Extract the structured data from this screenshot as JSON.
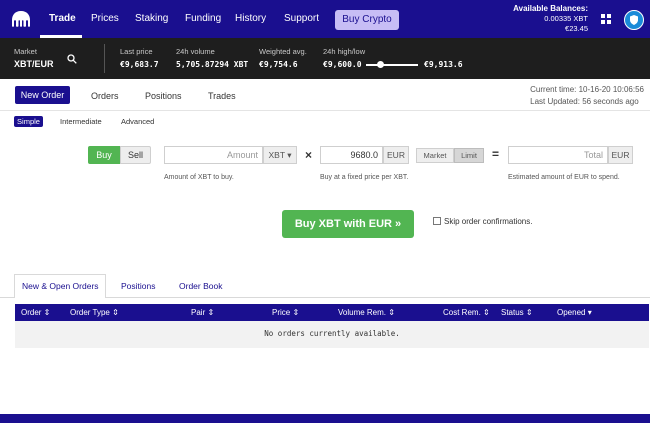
{
  "nav": {
    "items": [
      "Trade",
      "Prices",
      "Staking",
      "Funding",
      "History",
      "Support"
    ],
    "buy_crypto": "Buy Crypto"
  },
  "balances": {
    "title": "Available Balances:",
    "xbt": "0.00335 XBT",
    "eur": "€23.45"
  },
  "ticker": {
    "market_label": "Market",
    "pair": "XBT/EUR",
    "last_price_label": "Last price",
    "last_price": "€9,683.7",
    "volume_label": "24h volume",
    "volume": "5,705.87294 XBT",
    "weighted_label": "Weighted avg.",
    "weighted": "€9,754.6",
    "highlow_label": "24h high/low",
    "low": "€9,600.0",
    "high": "€9,913.6",
    "slider_fraction": 0.27
  },
  "order_tabs": [
    "New Order",
    "Orders",
    "Positions",
    "Trades"
  ],
  "time": {
    "current_label": "Current time:",
    "current": "10-16-20 10:06:56",
    "updated_label": "Last Updated:",
    "updated": "56 seconds ago"
  },
  "modes": [
    "Simple",
    "Intermediate",
    "Advanced"
  ],
  "form": {
    "buy": "Buy",
    "sell": "Sell",
    "amount_placeholder": "Amount",
    "amount_unit": "XBT ▾",
    "times": "×",
    "price_value": "9680.0",
    "price_unit": "EUR",
    "market": "Market",
    "limit": "Limit",
    "equals": "=",
    "total_placeholder": "Total",
    "total_unit": "EUR",
    "hint_amount": "Amount of XBT to buy.",
    "hint_price": "Buy at a fixed price per XBT.",
    "hint_total": "Estimated amount of EUR to spend.",
    "submit": "Buy XBT with EUR »",
    "skip_confirm": "Skip order confirmations."
  },
  "bottom_tabs": [
    "New & Open Orders",
    "Positions",
    "Order Book"
  ],
  "table": {
    "headers": [
      "Order ⇕",
      "Order Type ⇕",
      "Pair ⇕",
      "Price ⇕",
      "Volume Rem. ⇕",
      "Cost Rem. ⇕",
      "Status ⇕",
      "Opened ▾"
    ],
    "empty": "No orders currently available."
  },
  "colors": {
    "brand": "#1a0f8f",
    "buy_green": "#52b552",
    "ticker_bg": "#1e1e1e"
  }
}
